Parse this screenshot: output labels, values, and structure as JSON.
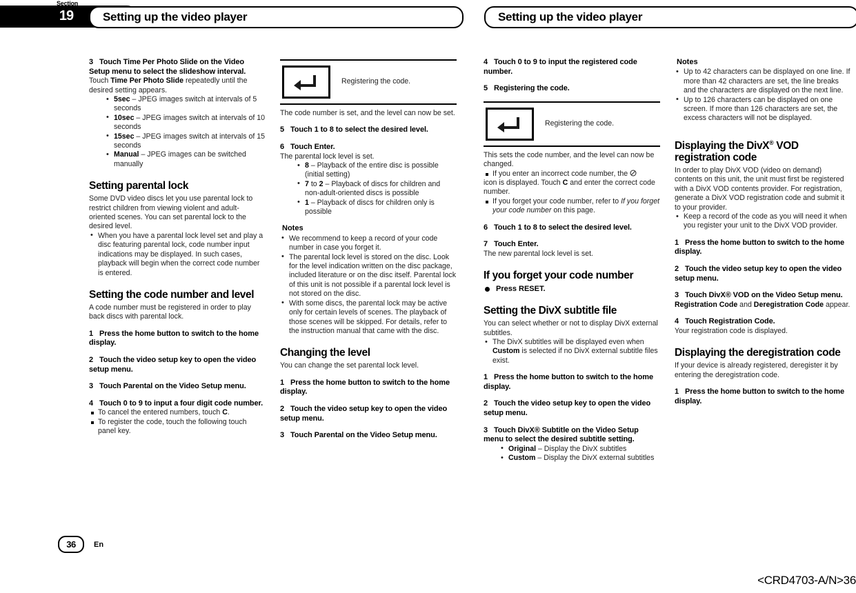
{
  "header": {
    "section_label": "Section",
    "section_number": "19",
    "title_left": "Setting up the video player",
    "title_right": "Setting up the video player"
  },
  "footer": {
    "page_number": "36",
    "language": "En",
    "document_id": "<CRD4703-A/N>36"
  },
  "icons": {
    "enter_key": "enter-arrow-icon",
    "no_entry": "no-entry-icon"
  },
  "column1": {
    "step3": {
      "num": "3",
      "text": "Touch Time Per Photo Slide on the Video Setup menu to select the slideshow interval."
    },
    "step3_body_pre": "Touch ",
    "step3_body_bold": "Time Per Photo Slide",
    "step3_body_post": " repeatedly until the desired setting appears.",
    "interval_options": [
      {
        "term": "5sec",
        "desc": " – JPEG images switch at intervals of 5 seconds"
      },
      {
        "term": "10sec",
        "desc": " – JPEG images switch at intervals of 10 seconds"
      },
      {
        "term": "15sec",
        "desc": " – JPEG images switch at intervals of 15 seconds"
      },
      {
        "term": "Manual",
        "desc": " – JPEG images can be switched manually"
      }
    ],
    "heading_parental": "Setting parental lock",
    "parental_intro": "Some DVD video discs let you use parental lock to restrict children from viewing violent and adult-oriented scenes. You can set parental lock to the desired level.",
    "parental_bullet": "When you have a parental lock level set and play a disc featuring parental lock, code number input indications may be displayed. In such cases, playback will begin when the correct code number is entered.",
    "heading_code": "Setting the code number and level",
    "code_intro": "A code number must be registered in order to play back discs with parental lock.",
    "steps": [
      {
        "num": "1",
        "text": "Press the home button to switch to the home display."
      },
      {
        "num": "2",
        "text": "Touch the video setup key to open the video setup menu."
      },
      {
        "num": "3",
        "text": "Touch Parental on the Video Setup menu."
      },
      {
        "num": "4",
        "text": "Touch 0 to 9 to input a four digit code number."
      }
    ],
    "cancel_note_pre": "To cancel the entered numbers, touch ",
    "cancel_note_bold": "C",
    "cancel_note_post": ".",
    "register_note": "To register the code, touch the following touch panel key."
  },
  "column2": {
    "keyfig_caption": "Registering the code.",
    "after_key": "The code number is set, and the level can now be set.",
    "step5": {
      "num": "5",
      "text": "Touch 1 to 8 to select the desired level."
    },
    "step6": {
      "num": "6",
      "text": "Touch Enter."
    },
    "step6_body": "The parental lock level is set.",
    "levels": [
      {
        "term": "8",
        "desc": " – Playback of the entire disc is possible (initial setting)"
      },
      {
        "term": "7",
        "mid": " to ",
        "term2": "2",
        "desc": " – Playback of discs for children and non-adult-oriented discs is possible"
      },
      {
        "term": "1",
        "desc": " – Playback of discs for children only is possible"
      }
    ],
    "notes_head": "Notes",
    "notes": [
      "We recommend to keep a record of your code number in case you forget it.",
      "The parental lock level is stored on the disc. Look for the level indication written on the disc package, included literature or on the disc itself. Parental lock of this unit is not possible if a parental lock level is not stored on the disc.",
      "With some discs, the parental lock may be active only for certain levels of scenes. The playback of those scenes will be skipped. For details, refer to the instruction manual that came with the disc."
    ],
    "heading_changing": "Changing the level",
    "changing_intro": "You can change the set parental lock level.",
    "steps": [
      {
        "num": "1",
        "text": "Press the home button to switch to the home display."
      },
      {
        "num": "2",
        "text": "Touch the video setup key to open the video setup menu."
      },
      {
        "num": "3",
        "text": "Touch Parental on the Video Setup menu."
      }
    ]
  },
  "column3": {
    "step4": {
      "num": "4",
      "text": "Touch 0 to 9 to input the registered code number."
    },
    "step5": {
      "num": "5",
      "text": "Registering the code."
    },
    "keyfig_caption": "Registering the code.",
    "after_key": "This sets the code number, and the level can now be changed.",
    "incorrect_note_pre": "If you enter an incorrect code number, the ",
    "incorrect_note_mid": " icon is displayed. Touch ",
    "incorrect_note_bold": "C",
    "incorrect_note_post": " and enter the correct code number.",
    "forget_note_pre": "If you forget your code number, refer to ",
    "forget_note_italic": "If you forget your code number",
    "forget_note_post": " on this page.",
    "step6": {
      "num": "6",
      "text": "Touch 1 to 8 to select the desired level."
    },
    "step7": {
      "num": "7",
      "text": "Touch Enter."
    },
    "step7_body": "The new parental lock level is set.",
    "heading_forget": "If you forget your code number",
    "press_reset": "Press RESET.",
    "heading_subtitle": "Setting the DivX subtitle file",
    "subtitle_intro": "You can select whether or not to display DivX external subtitles.",
    "subtitle_bullet_pre": "The DivX subtitles will be displayed even when ",
    "subtitle_bullet_bold": "Custom",
    "subtitle_bullet_post": " is selected if no DivX external subtitle files exist.",
    "steps": [
      {
        "num": "1",
        "text": "Press the home button to switch to the home display."
      },
      {
        "num": "2",
        "text": "Touch the video setup key to open the video setup menu."
      },
      {
        "num": "3",
        "text": "Touch DivX® Subtitle on the Video Setup menu to select the desired subtitle setting."
      }
    ],
    "subtitle_options": [
      {
        "term": "Original",
        "desc": " – Display the DivX subtitles"
      },
      {
        "term": "Custom",
        "desc": " – Display the DivX external subtitles"
      }
    ]
  },
  "column4": {
    "notes_head": "Notes",
    "notes": [
      "Up to 42 characters can be displayed on one line. If more than 42 characters are set, the line breaks and the characters are displayed on the next line.",
      "Up to 126 characters can be displayed on one screen. If more than 126 characters are set, the excess characters will not be displayed."
    ],
    "heading_vod_line1": "Displaying the DivX",
    "heading_vod_sup": "®",
    "heading_vod_line1b": " VOD",
    "heading_vod_line2": "registration code",
    "vod_intro": "In order to play DivX VOD (video on demand) contents on this unit, the unit must first be registered with a DivX VOD contents provider. For registration, generate a DivX VOD registration code and submit it to your provider.",
    "vod_bullet": "Keep a record of the code as you will need it when you register your unit to the DivX VOD provider.",
    "steps": [
      {
        "num": "1",
        "text": "Press the home button to switch to the home display."
      },
      {
        "num": "2",
        "text": "Touch the video setup key to open the video setup menu."
      },
      {
        "num": "3",
        "text": "Touch DivX® VOD on the Video Setup menu."
      }
    ],
    "appear_pre_bold": "Registration Code",
    "appear_mid": " and ",
    "appear_post_bold": "Deregistration Code",
    "appear_tail": " appear.",
    "step4": {
      "num": "4",
      "text": "Touch Registration Code."
    },
    "step4_body": "Your registration code is displayed.",
    "heading_dereg": "Displaying the deregistration code",
    "dereg_intro": "If your device is already registered, deregister it by entering the deregistration code.",
    "dereg_step1": {
      "num": "1",
      "text": "Press the home button to switch to the home display."
    }
  }
}
